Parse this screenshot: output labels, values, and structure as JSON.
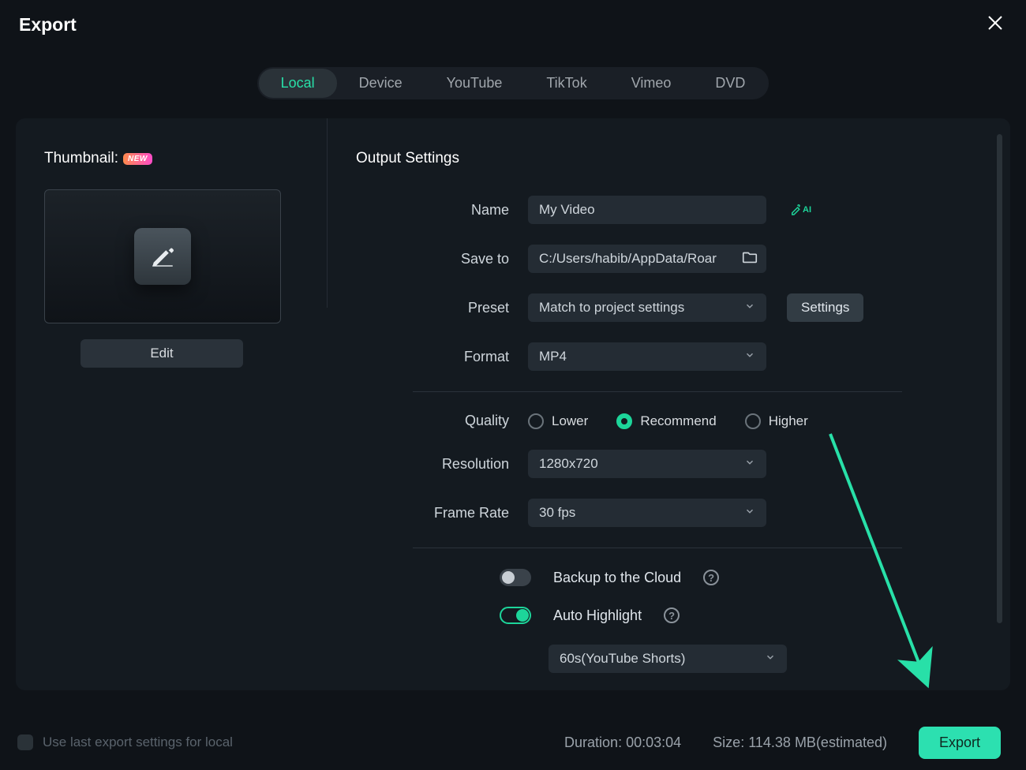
{
  "title": "Export",
  "tabs": [
    "Local",
    "Device",
    "YouTube",
    "TikTok",
    "Vimeo",
    "DVD"
  ],
  "activeTab": 0,
  "thumbnail": {
    "label": "Thumbnail:",
    "badge": "NEW",
    "editButton": "Edit"
  },
  "output": {
    "sectionTitle": "Output Settings",
    "nameLabel": "Name",
    "nameValue": "My Video",
    "aiBadge": "AI",
    "saveToLabel": "Save to",
    "saveToValue": "C:/Users/habib/AppData/Roar",
    "presetLabel": "Preset",
    "presetValue": "Match to project settings",
    "settingsButton": "Settings",
    "formatLabel": "Format",
    "formatValue": "MP4",
    "qualityLabel": "Quality",
    "qualityOptions": [
      "Lower",
      "Recommend",
      "Higher"
    ],
    "qualitySelected": 1,
    "resolutionLabel": "Resolution",
    "resolutionValue": "1280x720",
    "frameRateLabel": "Frame Rate",
    "frameRateValue": "30 fps",
    "backupLabel": "Backup to the Cloud",
    "backupOn": false,
    "highlightLabel": "Auto Highlight",
    "highlightOn": true,
    "highlightPreset": "60s(YouTube Shorts)"
  },
  "footer": {
    "checkboxLabel": "Use last export settings for local",
    "durationLabel": "Duration:",
    "durationValue": "00:03:04",
    "sizeLabel": "Size:",
    "sizeValue": "114.38 MB(estimated)",
    "exportButton": "Export"
  }
}
